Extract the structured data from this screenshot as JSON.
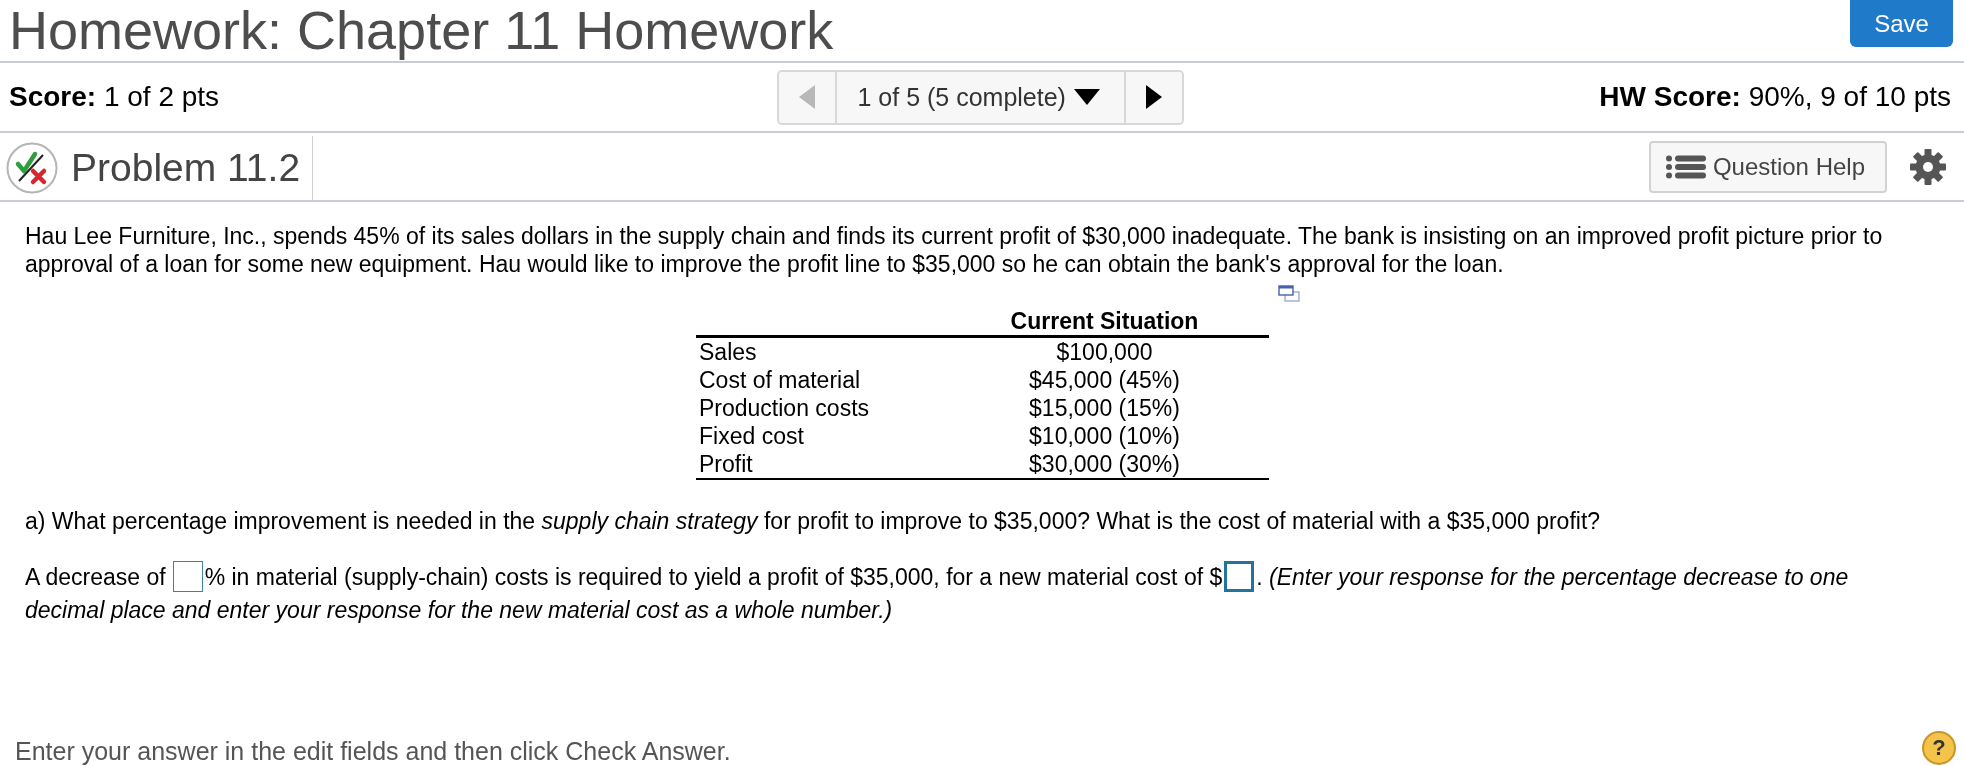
{
  "header": {
    "title": "Homework: Chapter 11 Homework",
    "save_button": "Save"
  },
  "score_bar": {
    "score_label": "Score:",
    "score_value": "1 of 2 pts",
    "navigator": {
      "previous": {
        "disabled": true
      },
      "position": "1 of 5 (5 complete)",
      "next": {
        "disabled": false
      }
    },
    "hw_score_label": "HW Score:",
    "hw_score_value": "90%, 9 of 10 pts"
  },
  "problem_bar": {
    "title": "Problem 11.2",
    "help_button": "Question Help"
  },
  "problem": {
    "intro": "Hau Lee Furniture, Inc., spends 45% of its sales dollars in the supply chain and finds its current profit of $30,000 inadequate. The bank is insisting on an improved profit picture prior to approval of a loan for some new equipment. Hau would like to improve the profit line to $35,000 so he can obtain the bank's approval for the loan.",
    "table": {
      "column_header": "Current Situation",
      "rows": [
        {
          "label": "Sales",
          "value": "$100,000"
        },
        {
          "label": "Cost of material",
          "value": "$45,000 (45%)"
        },
        {
          "label": "Production costs",
          "value": "$15,000 (15%)"
        },
        {
          "label": "Fixed cost",
          "value": "$10,000 (10%)"
        },
        {
          "label": "Profit",
          "value": "$30,000 (30%)"
        }
      ]
    },
    "question": "a) What percentage improvement is needed in the *supply chain strategy* for profit to improve to $35,000? What is the cost of material with a $35,000 profit?",
    "answer_lines": [
      [
        {
          "kind": "text",
          "text": "A decrease of"
        },
        {
          "kind": "blank",
          "focused": false
        },
        {
          "kind": "text",
          "text": "% in material (supply-chain) costs is required to yield a profit of $35,000, for a new material cost of $"
        },
        {
          "kind": "blank",
          "focused": true
        },
        {
          "kind": "text",
          "text": ". *(Enter your response for the percentage decrease to one*"
        }
      ],
      [
        {
          "kind": "note",
          "text": "decimal place and enter your response for the new material cost as a whole number.)"
        }
      ]
    ]
  },
  "footer": {
    "instruction": "Enter your answer in the edit fields and then click Check Answer.",
    "help_button": "?"
  }
}
